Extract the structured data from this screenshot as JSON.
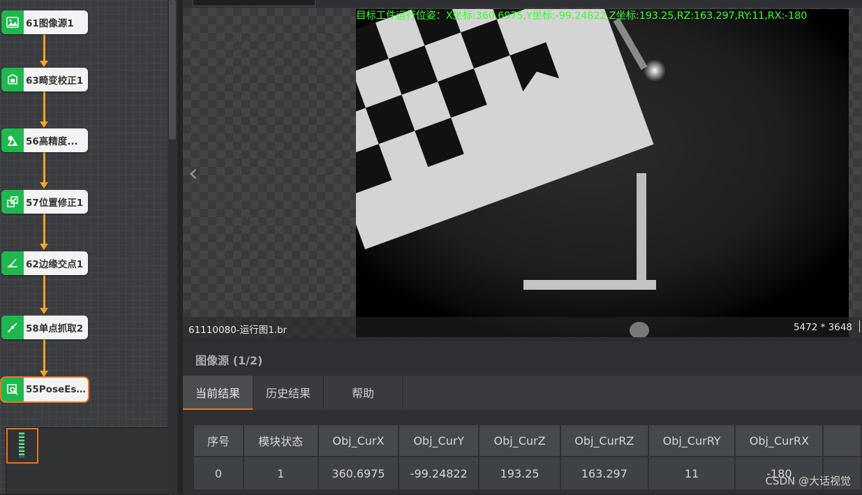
{
  "flow": {
    "nodes": [
      {
        "label": "61图像源1",
        "icon": "image-icon"
      },
      {
        "label": "63畸变校正1",
        "icon": "distortion-correction-icon"
      },
      {
        "label": "56高精度...",
        "icon": "high-precision-match-icon"
      },
      {
        "label": "57位置修正1",
        "icon": "position-correction-icon"
      },
      {
        "label": "62边缘交点1",
        "icon": "edge-intersection-icon"
      },
      {
        "label": "58单点抓取2",
        "icon": "single-point-grab-icon"
      },
      {
        "label": "55PoseEst...",
        "icon": "pose-estimation-icon"
      }
    ],
    "selected_index": 6,
    "accent_color": "#1fb84f",
    "connector_color": "#f5a623"
  },
  "viewer": {
    "overlay_text": "目标工件运行位姿：X坐标:360.6975,Y坐标:-99.24822,Z坐标:193.25,RZ:163.297,RY:11,RX:-180",
    "overlay_color": "#3bff2e",
    "filename": "61110080-运行图1.br",
    "image_size": "5472 * 3648",
    "prev_icon": "chevron-left-icon"
  },
  "results": {
    "title": "图像源 (1/2)",
    "tabs": [
      {
        "label": "当前结果",
        "active": true
      },
      {
        "label": "历史结果",
        "active": false
      },
      {
        "label": "帮助",
        "active": false
      }
    ],
    "table": {
      "headers": [
        "序号",
        "模块状态",
        "Obj_CurX",
        "Obj_CurY",
        "Obj_CurZ",
        "Obj_CurRZ",
        "Obj_CurRY",
        "Obj_CurRX"
      ],
      "rows": [
        [
          "0",
          "1",
          "360.6975",
          "-99.24822",
          "193.25",
          "163.297",
          "11",
          "-180"
        ]
      ]
    },
    "active_tab_color": "#f0731f"
  },
  "watermark": "CSDN @大话视觉"
}
